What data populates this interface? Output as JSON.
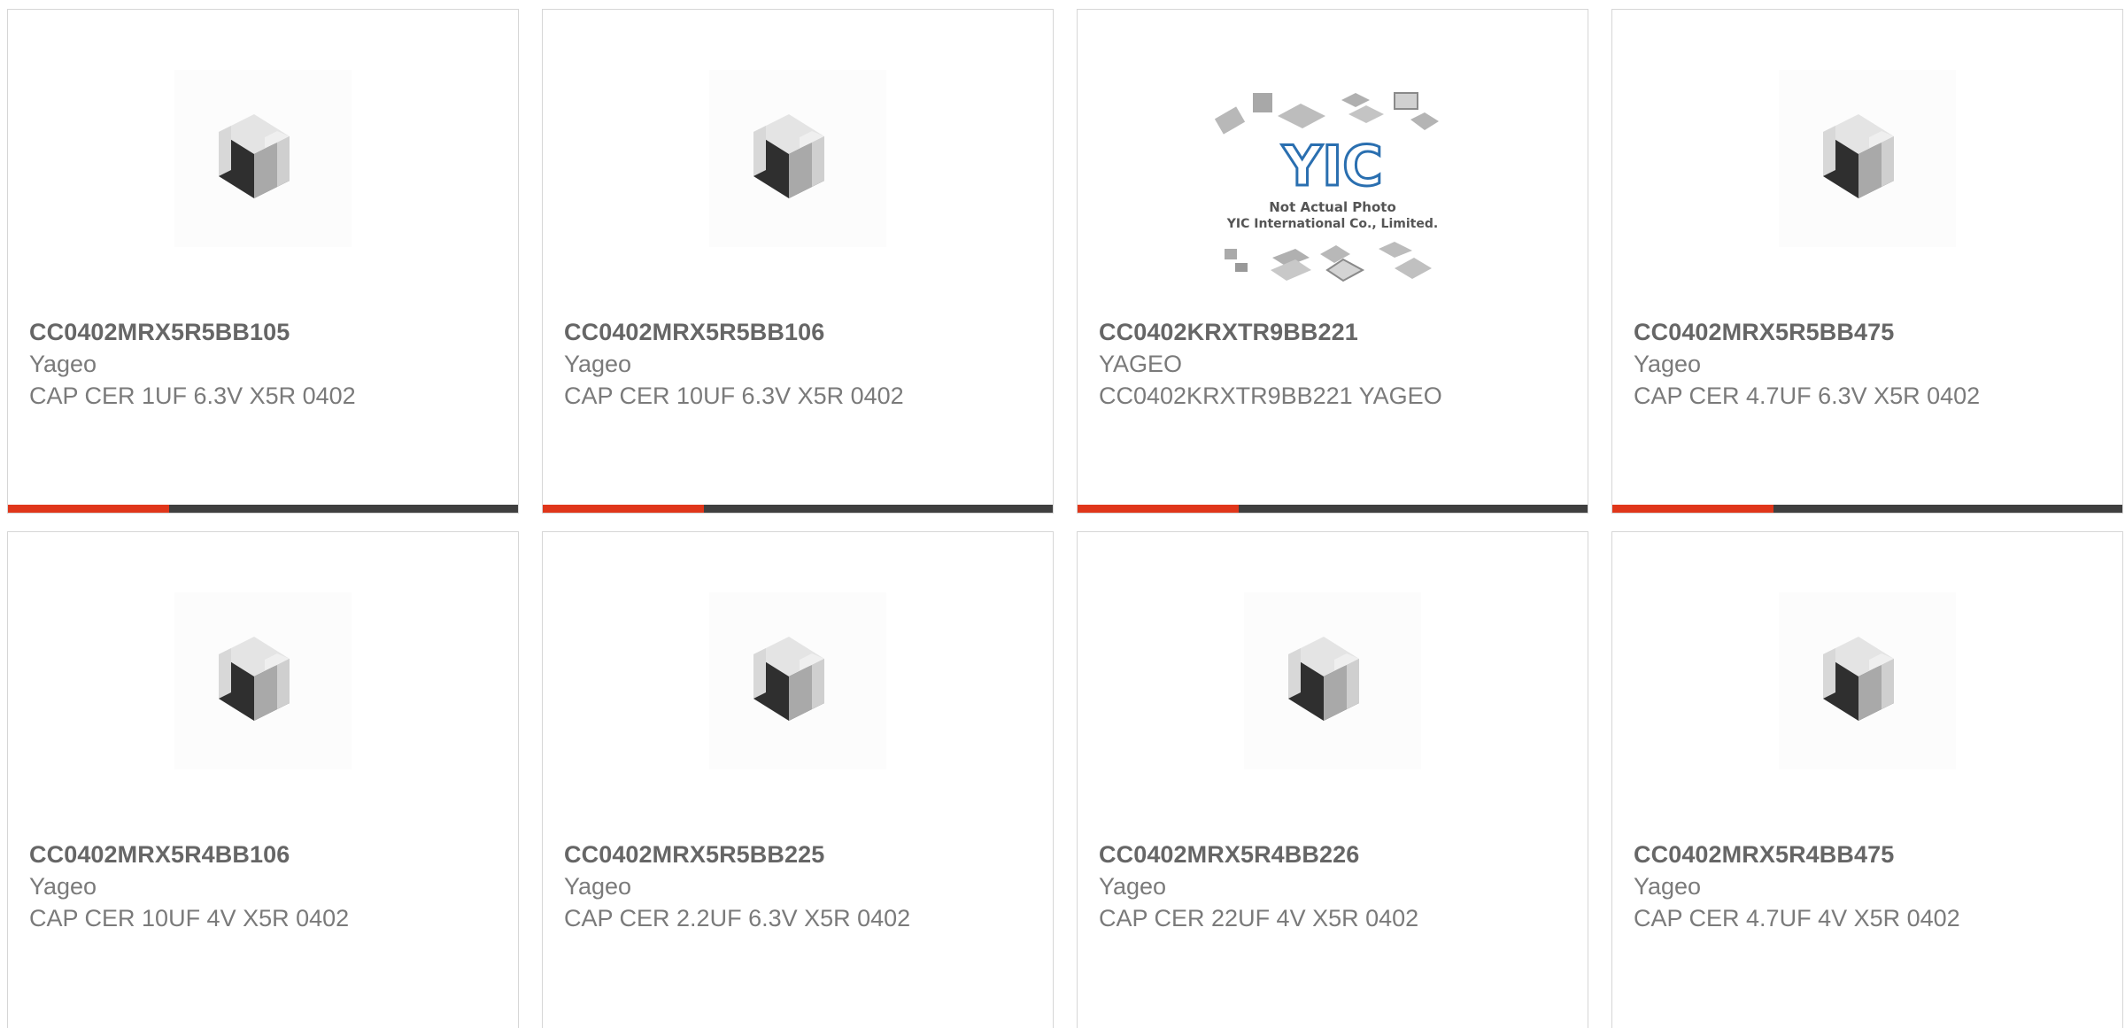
{
  "products": [
    {
      "part_number": "CC0402MRX5R5BB105",
      "manufacturer": "Yageo",
      "description": "CAP CER 1UF 6.3V X5R 0402",
      "image": "capacitor-chip-icon"
    },
    {
      "part_number": "CC0402MRX5R5BB106",
      "manufacturer": "Yageo",
      "description": "CAP CER 10UF 6.3V X5R 0402",
      "image": "capacitor-chip-icon"
    },
    {
      "part_number": "CC0402KRXTR9BB221",
      "manufacturer": "YAGEO",
      "description": "CC0402KRXTR9BB221 YAGEO",
      "image": "yic-placeholder-logo",
      "logo_text": {
        "brand": "YIC",
        "line1": "Not Actual Photo",
        "line2": "YIC International Co., Limited."
      }
    },
    {
      "part_number": "CC0402MRX5R5BB475",
      "manufacturer": "Yageo",
      "description": "CAP CER 4.7UF 6.3V X5R 0402",
      "image": "capacitor-chip-icon"
    },
    {
      "part_number": "CC0402MRX5R4BB106",
      "manufacturer": "Yageo",
      "description": "CAP CER 10UF 4V X5R 0402",
      "image": "capacitor-chip-icon"
    },
    {
      "part_number": "CC0402MRX5R5BB225",
      "manufacturer": "Yageo",
      "description": "CAP CER 2.2UF 6.3V X5R 0402",
      "image": "capacitor-chip-icon"
    },
    {
      "part_number": "CC0402MRX5R4BB226",
      "manufacturer": "Yageo",
      "description": "CAP CER 22UF 4V X5R 0402",
      "image": "capacitor-chip-icon"
    },
    {
      "part_number": "CC0402MRX5R4BB475",
      "manufacturer": "Yageo",
      "description": "CAP CER 4.7UF 4V X5R 0402",
      "image": "capacitor-chip-icon"
    }
  ],
  "colors": {
    "accent": "#e0361a",
    "bar_dark": "#3f3f3f",
    "border": "#d6d6d6",
    "text_bold": "#666666",
    "text": "#7a7a7a"
  }
}
